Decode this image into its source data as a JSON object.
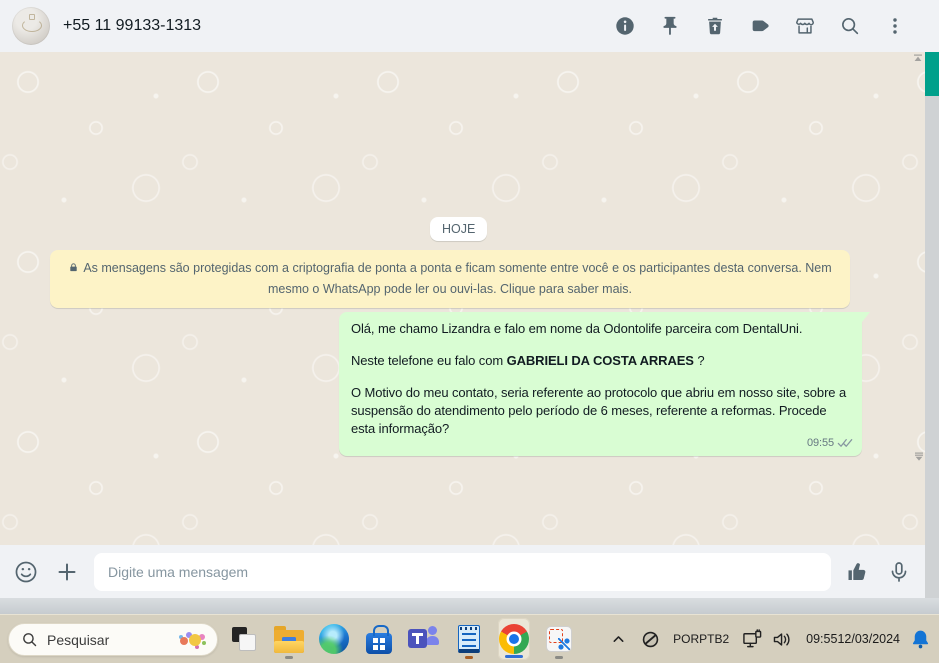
{
  "chat_header": {
    "contact_title": "+55 11 99133-1313",
    "action_icons": [
      "info-icon",
      "pin-icon",
      "trash-icon",
      "label-icon",
      "storefront-icon",
      "search-icon",
      "kebab-menu-icon"
    ]
  },
  "chat": {
    "date_badge": "HOJE",
    "encryption_notice": "As mensagens são protegidas com a criptografia de ponta a ponta e ficam somente entre você e os participantes desta conversa. Nem mesmo o WhatsApp pode ler ou ouvi-las. Clique para saber mais.",
    "message": {
      "p1": "Olá, me chamo Lizandra e falo em nome da Odontolife parceira com DentalUni.",
      "p2_prefix": "Neste telefone eu falo com ",
      "p2_bold": "GABRIELI DA COSTA ARRAES",
      "p2_suffix": " ?",
      "p3": "O Motivo do meu contato, seria referente ao protocolo que abriu em nosso site, sobre a suspensão do atendimento pelo período de 6 meses, referente a reformas. Procede esta informação?",
      "time": "09:55",
      "status": "delivered-double-check"
    }
  },
  "composer": {
    "placeholder": "Digite uma mensagem",
    "icons": [
      "emoji-icon",
      "plus-icon",
      "thumbs-up-icon",
      "microphone-icon"
    ]
  },
  "taskbar": {
    "search_label": "Pesquisar",
    "apps": [
      "task-view",
      "file-explorer",
      "edge",
      "microsoft-store",
      "teams",
      "notepad",
      "chrome",
      "snipping-tool"
    ],
    "active_app": "chrome",
    "running_apps": [
      "file-explorer",
      "notepad",
      "chrome",
      "snipping-tool"
    ],
    "tray": {
      "language_line1": "POR",
      "language_line2": "PTB2",
      "time": "09:55",
      "date": "12/03/2024",
      "icons": [
        "chevron-up-icon",
        "blocked-status-icon",
        "network-icon",
        "volume-icon",
        "notification-bell-icon"
      ]
    }
  },
  "colors": {
    "bubble_green": "#d9fdd3",
    "notice_yellow": "#fdf3c7",
    "scroll_thumb_green": "#00a08b",
    "bell_blue": "#1374d5",
    "header_bg": "#f0f2f5",
    "chat_bg": "#ece6dc",
    "taskbar_bg": "#d5cfbe",
    "icon_slate": "#54656f"
  }
}
